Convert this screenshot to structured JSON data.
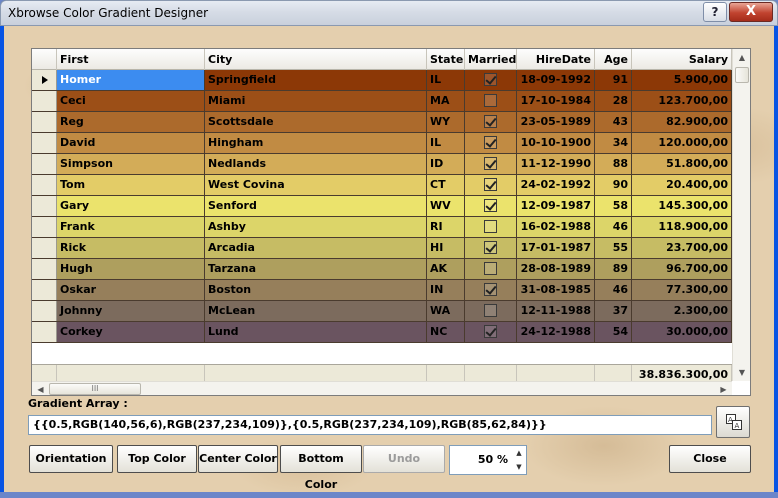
{
  "window": {
    "title": "Xbrowse Color Gradient Designer",
    "help_label": "?",
    "close_label": "X"
  },
  "grid": {
    "columns": [
      "First",
      "City",
      "State",
      "Married",
      "HireDate",
      "Age",
      "Salary"
    ],
    "rows": [
      {
        "first": "Homer",
        "city": "Springfield",
        "state": "IL",
        "married": true,
        "hire": "18-09-1992",
        "age": "91",
        "salary": "5.900,00",
        "color": "#8c3806"
      },
      {
        "first": "Ceci",
        "city": "Miami",
        "state": "MA",
        "married": false,
        "hire": "17-10-1984",
        "age": "28",
        "salary": "123.700,00",
        "color": "#9c4f17"
      },
      {
        "first": "Reg",
        "city": "Scottsdale",
        "state": "WY",
        "married": true,
        "hire": "23-05-1989",
        "age": "43",
        "salary": "82.900,00",
        "color": "#ac6a2c"
      },
      {
        "first": "David",
        "city": "Hingham",
        "state": "IL",
        "married": true,
        "hire": "10-10-1900",
        "age": "34",
        "salary": "120.000,00",
        "color": "#c18b43"
      },
      {
        "first": "Simpson",
        "city": "Nedlands",
        "state": "ID",
        "married": true,
        "hire": "11-12-1990",
        "age": "88",
        "salary": "51.800,00",
        "color": "#d3ac58"
      },
      {
        "first": "Tom",
        "city": "West Covina",
        "state": "CT",
        "married": true,
        "hire": "24-02-1992",
        "age": "90",
        "salary": "20.400,00",
        "color": "#e3cc67"
      },
      {
        "first": "Gary",
        "city": "Senford",
        "state": "WV",
        "married": true,
        "hire": "12-09-1987",
        "age": "58",
        "salary": "145.300,00",
        "color": "#ebe36c"
      },
      {
        "first": "Frank",
        "city": "Ashby",
        "state": "RI",
        "married": false,
        "hire": "16-02-1988",
        "age": "46",
        "salary": "118.900,00",
        "color": "#dcd569"
      },
      {
        "first": "Rick",
        "city": "Arcadia",
        "state": "HI",
        "married": true,
        "hire": "17-01-1987",
        "age": "55",
        "salary": "23.700,00",
        "color": "#c6bc64"
      },
      {
        "first": "Hugh",
        "city": "Tarzana",
        "state": "AK",
        "married": false,
        "hire": "28-08-1989",
        "age": "89",
        "salary": "96.700,00",
        "color": "#ae9f5e"
      },
      {
        "first": "Oskar",
        "city": "Boston",
        "state": "IN",
        "married": true,
        "hire": "31-08-1985",
        "age": "46",
        "salary": "77.300,00",
        "color": "#967f5b"
      },
      {
        "first": "Johnny",
        "city": "McLean",
        "state": "WA",
        "married": false,
        "hire": "12-11-1988",
        "age": "37",
        "salary": "2.300,00",
        "color": "#7c6b5d"
      },
      {
        "first": "Corkey",
        "city": "Lund",
        "state": "NC",
        "married": true,
        "hire": "24-12-1988",
        "age": "54",
        "salary": "30.000,00",
        "color": "#6a5460"
      }
    ],
    "footer_total": "38.836.300,00",
    "hscroll_grip": "III"
  },
  "gradient": {
    "label": "Gradient Array :",
    "value": "{{0.5,RGB(140,56,6),RGB(237,234,109)},{0.5,RGB(237,234,109),RGB(85,62,84)}}"
  },
  "buttons": {
    "orientation": "Orientation",
    "top_color": "Top Color",
    "center_color": "Center Color",
    "bottom_color": "Bottom Color",
    "undo": "Undo",
    "close": "Close"
  },
  "spinner": {
    "value": "50 %"
  }
}
